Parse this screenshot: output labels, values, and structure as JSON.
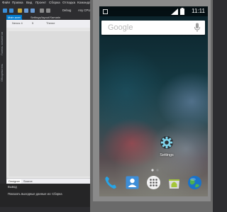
{
  "ide": {
    "menu": [
      "Файл",
      "Правка",
      "Вид",
      "Проект",
      "Сборка",
      "Отладка",
      "Команда"
    ],
    "toolbar": {
      "config": "Debug",
      "platform": "Any CPU"
    },
    "left_rail": [
      "Панель элементов",
      "Обозреватель"
    ],
    "doc_tabs": [
      "Main.axml",
      "Settings/layout/Xamarin"
    ],
    "designer_toolbar": {
      "device": "Nexus 4",
      "zoom": "5",
      "theme": "Theme"
    },
    "bottom_tabs": [
      "Designer",
      "Source"
    ],
    "output": {
      "title": "Вывод",
      "line": "Показать выходные данные из:  Сборка"
    }
  },
  "emulator": {
    "status": {
      "time": "11:11"
    },
    "search": {
      "placeholder": "Google"
    },
    "home_app": {
      "label": "Settings"
    },
    "dock_icons": [
      "phone-icon",
      "contacts-icon",
      "app-drawer-icon",
      "android-market-icon",
      "browser-globe-icon"
    ],
    "page_indicator": {
      "pages": 2,
      "active": 0
    }
  }
}
